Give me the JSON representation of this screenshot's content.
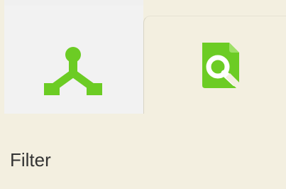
{
  "tabs": [
    {
      "icon": "hierarchy-icon",
      "selected": false
    },
    {
      "icon": "search-document-icon",
      "selected": true
    }
  ],
  "panel": {
    "label": "Filter"
  },
  "colors": {
    "accent": "#6ccc24",
    "panel_background": "#f3efe0",
    "inactive_tab_background": "#f2f2f2",
    "text": "#333333"
  }
}
